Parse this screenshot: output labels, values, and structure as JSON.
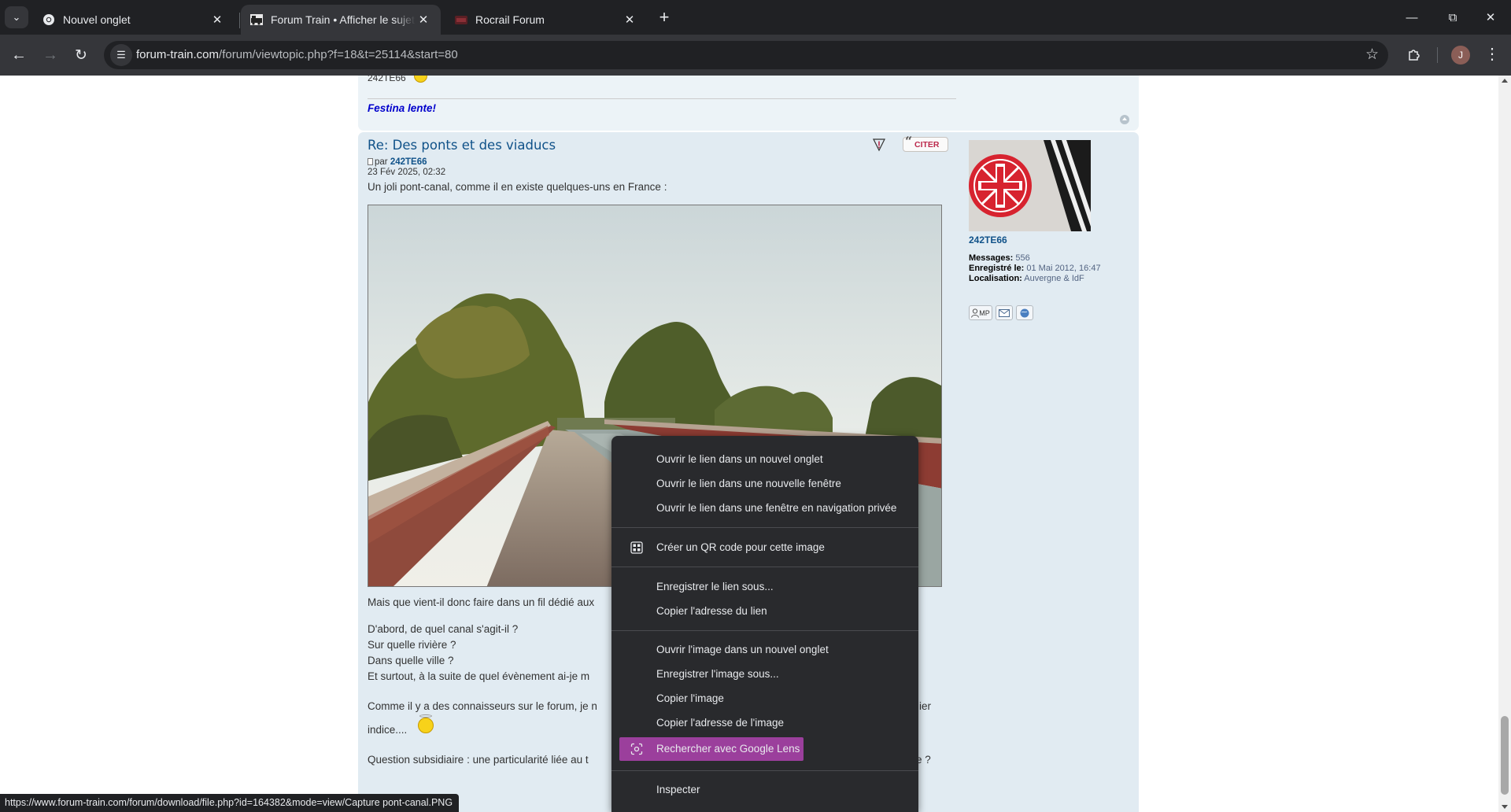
{
  "browser": {
    "tabs": [
      {
        "title": "Nouvel onglet",
        "active": false
      },
      {
        "title": "Forum Train • Afficher le sujet - Des ponts et des viaducs",
        "active": true
      },
      {
        "title": "Rocrail Forum",
        "active": false
      }
    ],
    "url_host": "forum-train.com",
    "url_path": "/forum/viewtopic.php?f=18&t=25114&start=80",
    "profile_initial": "J"
  },
  "prev_post": {
    "cut_text": "242TE66",
    "signature": "Festina lente!"
  },
  "post": {
    "title": "Re: Des ponts et des viaducs",
    "quote_label": "CITER",
    "by_prefix": "par",
    "author": "242TE66",
    "date": "23 Fév 2025, 02:32",
    "intro": "Un joli pont-canal, comme il en existe quelques-uns en France :",
    "lines": [
      "Mais que vient-il donc faire dans un fil dédié aux",
      "D'abord, de quel canal s'agit-il ?",
      "Sur quelle rivière ?",
      "Dans quelle ville ?",
      "Et surtout, à la suite de quel évènement ai-je m",
      "Comme il y a des connaisseurs sur le forum, je n",
      "ier",
      "indice....",
      "Question subsidiaire : une particularité liée au t",
      "e ?"
    ]
  },
  "profile": {
    "username": "242TE66",
    "messages_label": "Messages:",
    "messages_value": "556",
    "registered_label": "Enregistré le:",
    "registered_value": "01 Mai 2012, 16:47",
    "location_label": "Localisation:",
    "location_value": "Auvergne & IdF",
    "pm_label": "MP"
  },
  "context_menu": {
    "items": [
      "Ouvrir le lien dans un nouvel onglet",
      "Ouvrir le lien dans une nouvelle fenêtre",
      "Ouvrir le lien dans une fenêtre en navigation privée",
      "Créer un QR code pour cette image",
      "Enregistrer le lien sous...",
      "Copier l'adresse du lien",
      "Ouvrir l'image dans un nouvel onglet",
      "Enregistrer l'image sous...",
      "Copier l'image",
      "Copier l'adresse de l'image",
      "Rechercher avec Google Lens",
      "Inspecter"
    ],
    "highlighted_color": "#9b3f9c"
  },
  "status_bar": "https://www.forum-train.com/forum/download/file.php?id=164382&mode=view/Capture pont-canal.PNG"
}
